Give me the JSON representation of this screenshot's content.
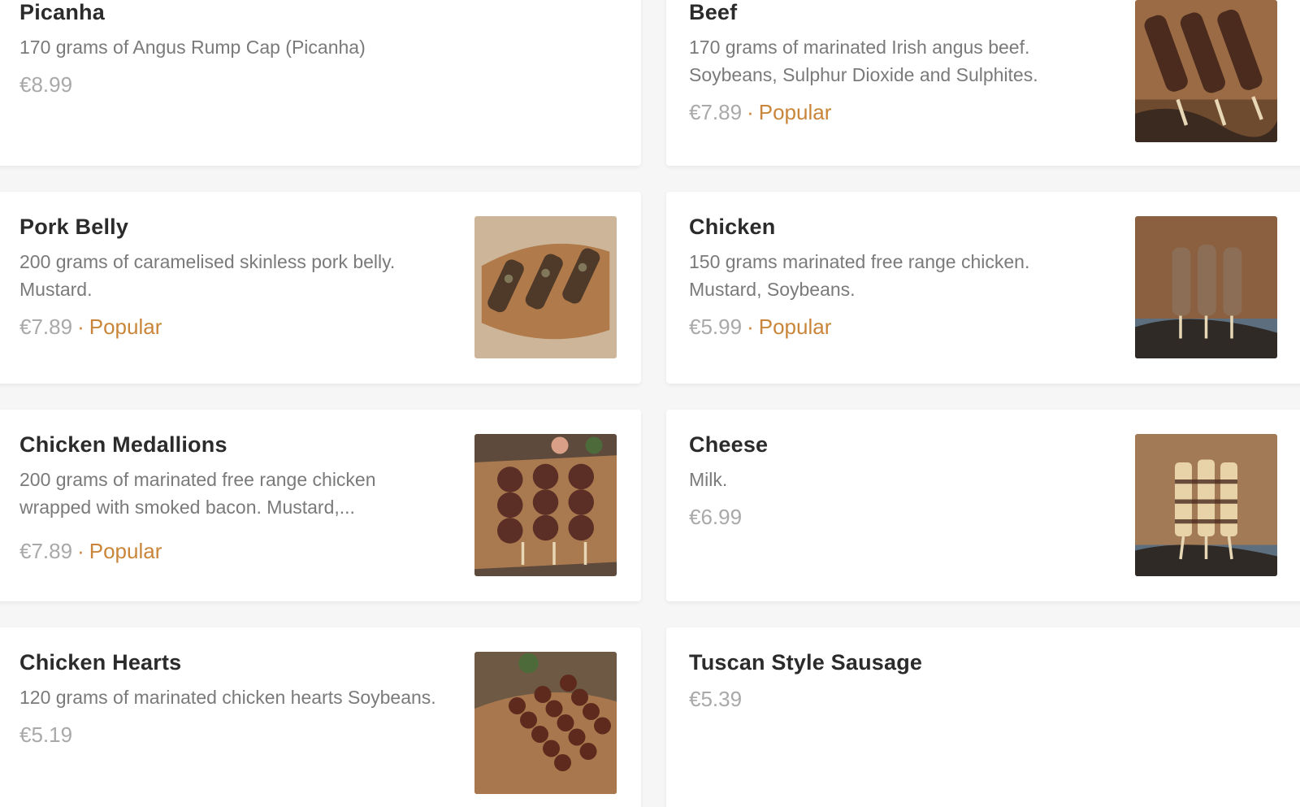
{
  "items": [
    {
      "name": "Picanha",
      "desc": "170 grams of Angus Rump Cap (Picanha)",
      "price": "€8.99",
      "popular": ""
    },
    {
      "name": "Beef",
      "desc": "170 grams of marinated Irish angus beef. Soybeans, Sulphur Dioxide and Sulphites.",
      "price": "€7.89",
      "popular": "Popular"
    },
    {
      "name": "Pork Belly",
      "desc": "200 grams of caramelised skinless pork belly. Mustard.",
      "price": "€7.89",
      "popular": "Popular"
    },
    {
      "name": "Chicken",
      "desc": "150 grams marinated free range chicken. Mustard, Soybeans.",
      "price": "€5.99",
      "popular": "Popular"
    },
    {
      "name": "Chicken Medallions",
      "desc": "200 grams of marinated free range chicken wrapped with smoked bacon. Mustard,...",
      "price": "€7.89",
      "popular": "Popular"
    },
    {
      "name": "Cheese",
      "desc": "Milk.",
      "price": "€6.99",
      "popular": ""
    },
    {
      "name": "Chicken Hearts",
      "desc": "120 grams of marinated chicken hearts Soybeans.",
      "price": "€5.19",
      "popular": ""
    },
    {
      "name": "Tuscan Style Sausage",
      "desc": "",
      "price": "€5.39",
      "popular": ""
    }
  ],
  "dot": "·",
  "colors": {
    "accent": "#c9853a",
    "title": "#2b2b2b",
    "desc": "#7a7a7a",
    "price": "#a9a9a9",
    "wood": "#b8875a",
    "meat": "#5a3322"
  }
}
